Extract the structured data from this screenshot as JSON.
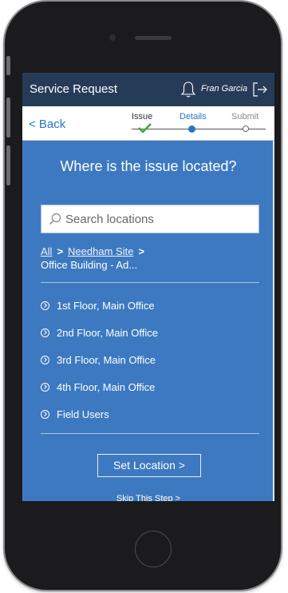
{
  "header": {
    "title": "Service Request",
    "user_name": "Fran Garcia"
  },
  "nav": {
    "back_label": "< Back"
  },
  "steps": [
    {
      "label": "Issue",
      "state": "completed"
    },
    {
      "label": "Details",
      "state": "current"
    },
    {
      "label": "Submit",
      "state": "upcoming"
    }
  ],
  "panel": {
    "heading": "Where is the issue located?",
    "search_placeholder": "Search locations"
  },
  "breadcrumb": {
    "all": "All",
    "site": "Needham Site",
    "current": "Office Building - Ad..."
  },
  "locations": [
    "1st Floor, Main Office",
    "2nd Floor, Main Office",
    "3rd Floor, Main Office",
    "4th Floor, Main Office",
    "Field Users"
  ],
  "actions": {
    "set_location": "Set Location >",
    "skip": "Skip This Step >"
  },
  "colors": {
    "topbar": "#263b58",
    "panel": "#3d79c0",
    "accent": "#2a74c8",
    "check": "#3aa83a"
  },
  "icons": [
    "bell-icon",
    "logout-icon",
    "search-icon",
    "check-icon",
    "circle-arrow-icon"
  ]
}
